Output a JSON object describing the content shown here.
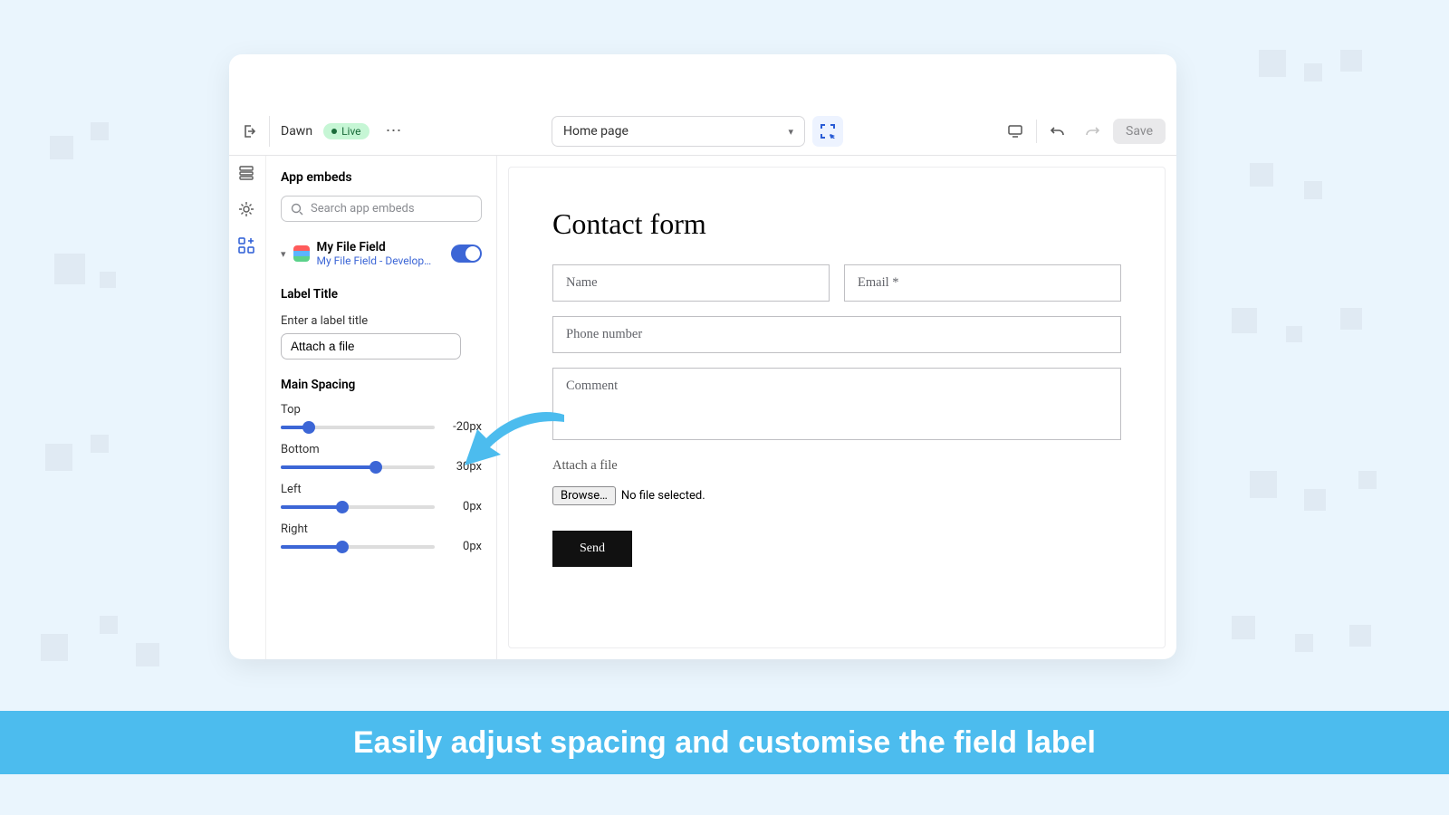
{
  "caption": "Easily adjust spacing and customise the field label",
  "topbar": {
    "theme_name": "Dawn",
    "live_label": "Live",
    "page_select": "Home page",
    "save_label": "Save"
  },
  "sidebar": {
    "title": "App embeds",
    "search_placeholder": "Search app embeds",
    "embed": {
      "name": "My File Field",
      "subtitle": "My File Field - Develop…",
      "enabled": true
    },
    "label_title_heading": "Label Title",
    "enter_label": "Enter a label title",
    "label_value": "Attach a file",
    "main_spacing_heading": "Main Spacing",
    "sliders": {
      "top": {
        "label": "Top",
        "value": "-20px",
        "pct": 18
      },
      "bottom": {
        "label": "Bottom",
        "value": "30px",
        "pct": 62
      },
      "left": {
        "label": "Left",
        "value": "0px",
        "pct": 40
      },
      "right": {
        "label": "Right",
        "value": "0px",
        "pct": 40
      }
    }
  },
  "form": {
    "title": "Contact form",
    "name": "Name",
    "email": "Email *",
    "phone": "Phone number",
    "comment": "Comment",
    "attach": "Attach a file",
    "browse": "Browse…",
    "nofile": "No file selected.",
    "send": "Send"
  }
}
